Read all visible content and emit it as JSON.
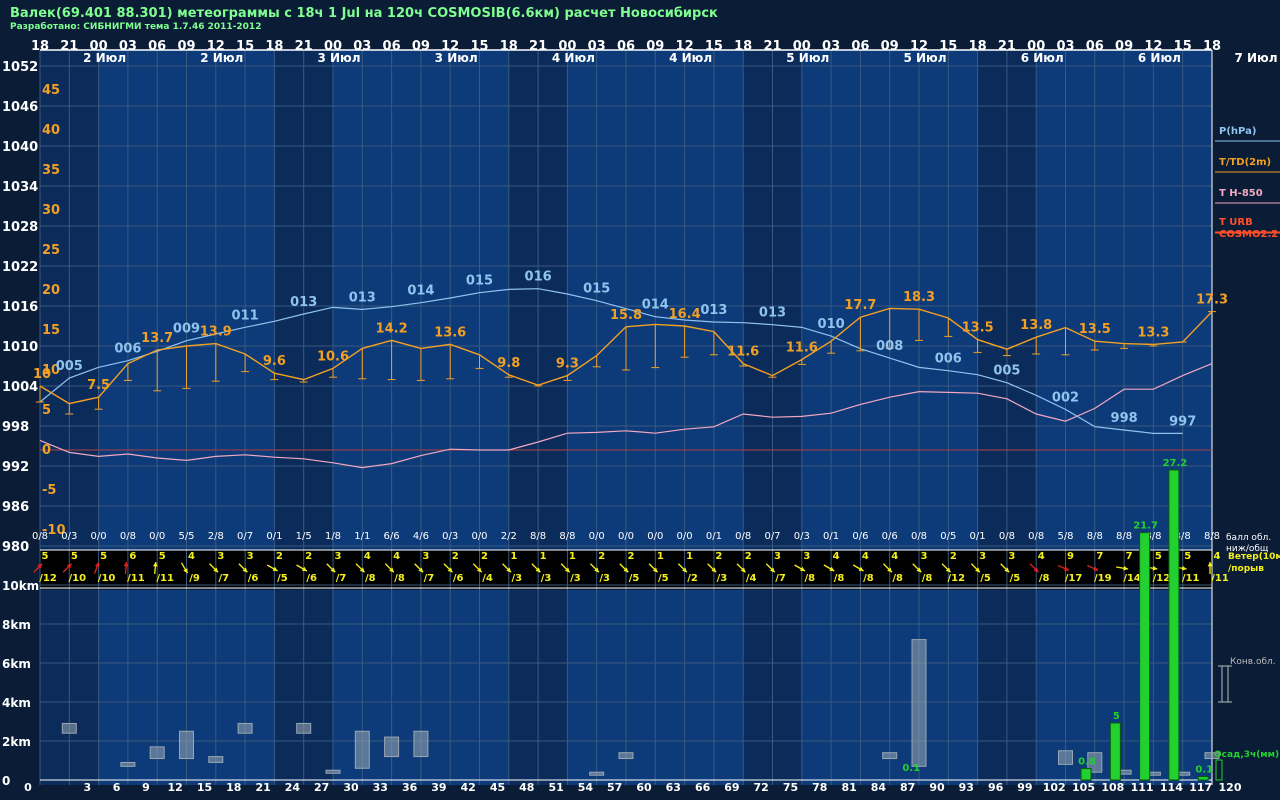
{
  "title": "Валек(69.401 88.301) метеограммы с  18ч 1 Jul на 120ч COSMOSIB(6.6км) расчет Новосибирск",
  "subtitle": "Разработано: СИБНИГМИ тема 1.7.46 2011-2012",
  "colors": {
    "pressure": "#8fc4ef",
    "temp": "#f2a024",
    "t850": "#f1a8c0",
    "urb": "#ff4f2a",
    "zero": "#b04040",
    "wind_yellow": "#f4f01c",
    "wind_red": "#e02020",
    "precip": "#22d030",
    "cloud": "#9aa7b2"
  },
  "chart_data": {
    "type": "line",
    "hours_top": [
      "18",
      "21",
      "00",
      "03",
      "06",
      "09",
      "12",
      "15",
      "18",
      "21",
      "00",
      "03",
      "06",
      "09",
      "12",
      "15",
      "18",
      "21",
      "00",
      "03",
      "06",
      "09",
      "12",
      "15",
      "18",
      "21",
      "00",
      "03",
      "06",
      "09",
      "12",
      "15",
      "18",
      "21",
      "00",
      "03",
      "06",
      "09",
      "12",
      "15",
      "18"
    ],
    "hours_bottom": [
      "0",
      "3",
      "6",
      "9",
      "12",
      "15",
      "18",
      "21",
      "24",
      "27",
      "30",
      "33",
      "36",
      "39",
      "42",
      "45",
      "48",
      "51",
      "54",
      "57",
      "60",
      "63",
      "66",
      "69",
      "72",
      "75",
      "78",
      "81",
      "84",
      "87",
      "90",
      "93",
      "96",
      "99",
      "102",
      "105",
      "108",
      "111",
      "114",
      "117",
      "120"
    ],
    "dates": [
      {
        "h": 6,
        "label": "2 Июл"
      },
      {
        "h": 18,
        "label": "2 Июл"
      },
      {
        "h": 30,
        "label": "3 Июл"
      },
      {
        "h": 42,
        "label": "3 Июл"
      },
      {
        "h": 54,
        "label": "4 Июл"
      },
      {
        "h": 66,
        "label": "4 Июл"
      },
      {
        "h": 78,
        "label": "5 Июл"
      },
      {
        "h": 90,
        "label": "5 Июл"
      },
      {
        "h": 102,
        "label": "6 Июл"
      },
      {
        "h": 114,
        "label": "6 Июл"
      }
    ],
    "date_right": "7 Июл",
    "pressure_ticks": [
      "1052",
      "1046",
      "1040",
      "1034",
      "1028",
      "1022",
      "1016",
      "1010",
      "1004",
      "998",
      "992",
      "986",
      "980"
    ],
    "temp_ticks": [
      "45",
      "40",
      "35",
      "30",
      "25",
      "20",
      "15",
      "10",
      "5",
      "0",
      "-5",
      "-10"
    ],
    "pressure": [
      1001.6,
      1005.2,
      1006.8,
      1007.8,
      1009.2,
      1010.8,
      1011.8,
      1012.8,
      1013.7,
      1014.8,
      1015.8,
      1015.5,
      1015.9,
      1016.5,
      1017.2,
      1018.0,
      1018.5,
      1018.6,
      1017.8,
      1016.8,
      1015.6,
      1014.4,
      1013.9,
      1013.6,
      1013.5,
      1013.2,
      1012.8,
      1011.5,
      1009.6,
      1008.2,
      1006.8,
      1006.3,
      1005.7,
      1004.5,
      1002.6,
      1000.5,
      997.9,
      997.4,
      996.9,
      996.9
    ],
    "pressure_labels": [
      {
        "h": 3,
        "text": "005"
      },
      {
        "h": 9,
        "text": "006"
      },
      {
        "h": 15,
        "text": "009"
      },
      {
        "h": 21,
        "text": "011"
      },
      {
        "h": 27,
        "text": "013"
      },
      {
        "h": 33,
        "text": "013"
      },
      {
        "h": 39,
        "text": "014"
      },
      {
        "h": 45,
        "text": "015"
      },
      {
        "h": 51,
        "text": "016"
      },
      {
        "h": 57,
        "text": "015"
      },
      {
        "h": 63,
        "text": "014"
      },
      {
        "h": 69,
        "text": "013"
      },
      {
        "h": 75,
        "text": "013"
      },
      {
        "h": 81,
        "text": "010"
      },
      {
        "h": 87,
        "text": "008"
      },
      {
        "h": 93,
        "text": "006"
      },
      {
        "h": 99,
        "text": "005"
      },
      {
        "h": 105,
        "text": "002"
      },
      {
        "h": 111,
        "text": "998"
      },
      {
        "h": 117,
        "text": "997"
      }
    ],
    "temp": [
      8.0,
      5.8,
      6.6,
      10.8,
      12.5,
      13.0,
      13.3,
      12.0,
      9.6,
      8.8,
      10.2,
      12.7,
      13.7,
      12.7,
      13.2,
      11.9,
      9.4,
      8.1,
      9.3,
      11.8,
      15.4,
      15.7,
      15.5,
      14.8,
      10.8,
      9.3,
      11.3,
      13.6,
      16.6,
      17.7,
      17.6,
      16.5,
      13.8,
      12.6,
      14.1,
      15.3,
      13.6,
      13.3,
      13.2,
      13.5,
      17.3
    ],
    "td_bottom": [
      6.0,
      4.5,
      5.1,
      8.7,
      7.4,
      7.7,
      8.6,
      9.8,
      8.8,
      8.5,
      9.1,
      8.9,
      8.8,
      8.7,
      8.9,
      10.2,
      9.1,
      8.0,
      8.7,
      10.4,
      10.0,
      10.3,
      11.6,
      11.9,
      10.5,
      9.1,
      10.7,
      12.1,
      12.4,
      12.7,
      13.7,
      14.2,
      12.2,
      11.8,
      12.0,
      11.9,
      12.5,
      12.7,
      13.0,
      13.5,
      17.3
    ],
    "temp_labels": [
      {
        "h": 0,
        "text": "10"
      },
      {
        "h": 6,
        "text": "7.5"
      },
      {
        "h": 12,
        "text": "13.7"
      },
      {
        "h": 18,
        "text": "13.9"
      },
      {
        "h": 24,
        "text": "9.6"
      },
      {
        "h": 30,
        "text": "10.6"
      },
      {
        "h": 36,
        "text": "14.2"
      },
      {
        "h": 42,
        "text": "13.6"
      },
      {
        "h": 48,
        "text": "9.8"
      },
      {
        "h": 54,
        "text": "9.3"
      },
      {
        "h": 60,
        "text": "15.8"
      },
      {
        "h": 66,
        "text": "16.4"
      },
      {
        "h": 72,
        "text": "11.6"
      },
      {
        "h": 78,
        "text": "11.6"
      },
      {
        "h": 84,
        "text": "17.7"
      },
      {
        "h": 90,
        "text": "18.3"
      },
      {
        "h": 96,
        "text": "13.5"
      },
      {
        "h": 102,
        "text": "13.8"
      },
      {
        "h": 108,
        "text": "13.5"
      },
      {
        "h": 114,
        "text": "13.3"
      },
      {
        "h": 120,
        "text": "17.3"
      }
    ],
    "t850": [
      1.2,
      -0.3,
      -0.8,
      -0.5,
      -1.0,
      -1.3,
      -0.8,
      -0.6,
      -0.9,
      -1.1,
      -1.6,
      -2.2,
      -1.7,
      -0.7,
      0.1,
      0.0,
      0.0,
      1.0,
      2.1,
      2.2,
      2.4,
      2.1,
      2.6,
      2.9,
      4.5,
      4.1,
      4.2,
      4.6,
      5.7,
      6.6,
      7.3,
      7.2,
      7.1,
      6.4,
      4.5,
      3.6,
      5.2,
      7.6,
      7.6,
      9.3,
      10.8
    ],
    "clouds": [
      "0/8",
      "0/3",
      "0/0",
      "0/8",
      "0/0",
      "5/5",
      "2/8",
      "0/7",
      "0/1",
      "1/5",
      "1/8",
      "1/1",
      "6/6",
      "4/6",
      "0/3",
      "0/0",
      "2/2",
      "8/8",
      "8/8",
      "0/0",
      "0/0",
      "0/0",
      "0/0",
      "0/1",
      "0/8",
      "0/7",
      "0/3",
      "0/1",
      "0/6",
      "0/6",
      "0/8",
      "0/5",
      "0/1",
      "0/8",
      "0/8",
      "5/8",
      "8/8",
      "8/8",
      "8/8",
      "8/8",
      "8/8"
    ],
    "wind": [
      {
        "s": "5",
        "g": "/12",
        "c": "r",
        "d": 45
      },
      {
        "s": "5",
        "g": "/10",
        "c": "r",
        "d": 45
      },
      {
        "s": "5",
        "g": "/10",
        "c": "r",
        "d": 20
      },
      {
        "s": "6",
        "g": "/11",
        "c": "r",
        "d": 5
      },
      {
        "s": "5",
        "g": "/11",
        "c": "y",
        "d": 5
      },
      {
        "s": "4",
        "g": "/9",
        "c": "y",
        "d": 150
      },
      {
        "s": "3",
        "g": "/7",
        "c": "y",
        "d": 135
      },
      {
        "s": "3",
        "g": "/6",
        "c": "y",
        "d": 135
      },
      {
        "s": "2",
        "g": "/5",
        "c": "y",
        "d": 120
      },
      {
        "s": "2",
        "g": "/6",
        "c": "y",
        "d": 120
      },
      {
        "s": "3",
        "g": "/7",
        "c": "y",
        "d": 135
      },
      {
        "s": "4",
        "g": "/8",
        "c": "y",
        "d": 135
      },
      {
        "s": "4",
        "g": "/8",
        "c": "y",
        "d": 135
      },
      {
        "s": "3",
        "g": "/7",
        "c": "y",
        "d": 135
      },
      {
        "s": "2",
        "g": "/6",
        "c": "y",
        "d": 135
      },
      {
        "s": "2",
        "g": "/4",
        "c": "y",
        "d": 135
      },
      {
        "s": "1",
        "g": "/3",
        "c": "y",
        "d": 135
      },
      {
        "s": "1",
        "g": "/3",
        "c": "y",
        "d": 135
      },
      {
        "s": "1",
        "g": "/3",
        "c": "y",
        "d": 135
      },
      {
        "s": "2",
        "g": "/3",
        "c": "y",
        "d": 135
      },
      {
        "s": "2",
        "g": "/5",
        "c": "y",
        "d": 135
      },
      {
        "s": "1",
        "g": "/5",
        "c": "y",
        "d": 135
      },
      {
        "s": "1",
        "g": "/2",
        "c": "y",
        "d": 135
      },
      {
        "s": "2",
        "g": "/3",
        "c": "y",
        "d": 135
      },
      {
        "s": "2",
        "g": "/4",
        "c": "y",
        "d": 135
      },
      {
        "s": "3",
        "g": "/7",
        "c": "y",
        "d": 135
      },
      {
        "s": "3",
        "g": "/8",
        "c": "y",
        "d": 120
      },
      {
        "s": "4",
        "g": "/8",
        "c": "y",
        "d": 120
      },
      {
        "s": "4",
        "g": "/8",
        "c": "y",
        "d": 120
      },
      {
        "s": "4",
        "g": "/8",
        "c": "y",
        "d": 135
      },
      {
        "s": "3",
        "g": "/8",
        "c": "y",
        "d": 135
      },
      {
        "s": "2",
        "g": "/12",
        "c": "y",
        "d": 135
      },
      {
        "s": "3",
        "g": "/5",
        "c": "y",
        "d": 135
      },
      {
        "s": "3",
        "g": "/5",
        "c": "y",
        "d": 135
      },
      {
        "s": "4",
        "g": "/8",
        "c": "r",
        "d": 135
      },
      {
        "s": "9",
        "g": "/17",
        "c": "r",
        "d": 115
      },
      {
        "s": "7",
        "g": "/19",
        "c": "r",
        "d": 115
      },
      {
        "s": "7",
        "g": "/14",
        "c": "y",
        "d": 100
      },
      {
        "s": "5",
        "g": "/12",
        "c": "y",
        "d": 100
      },
      {
        "s": "5",
        "g": "/11",
        "c": "y",
        "d": 100
      },
      {
        "s": "4",
        "g": "/11",
        "c": "y",
        "d": 0
      }
    ],
    "precip": [
      {
        "h": 107,
        "v": 1.0,
        "label": "0.8"
      },
      {
        "h": 110,
        "v": 5.0,
        "label": "5"
      },
      {
        "h": 113,
        "v": 21.7,
        "label": "21.7"
      },
      {
        "h": 116,
        "v": 27.2,
        "label": "27.2"
      },
      {
        "h": 119,
        "v": 0.3,
        "label": "0.1"
      },
      {
        "h": 89,
        "v": 0.0,
        "label": "0.1"
      }
    ],
    "cloud_bars": [
      {
        "h": 3,
        "lo": 2.4,
        "hi": 2.9
      },
      {
        "h": 9,
        "lo": 0.7,
        "hi": 0.9
      },
      {
        "h": 12,
        "lo": 1.1,
        "hi": 1.7
      },
      {
        "h": 15,
        "lo": 1.1,
        "hi": 2.5
      },
      {
        "h": 18,
        "lo": 0.9,
        "hi": 1.2
      },
      {
        "h": 21,
        "lo": 2.4,
        "hi": 2.9
      },
      {
        "h": 27,
        "lo": 2.4,
        "hi": 2.9
      },
      {
        "h": 30,
        "lo": 0.4,
        "hi": 0.5
      },
      {
        "h": 33,
        "lo": 0.6,
        "hi": 2.5
      },
      {
        "h": 36,
        "lo": 1.2,
        "hi": 2.2
      },
      {
        "h": 39,
        "lo": 1.2,
        "hi": 2.5
      },
      {
        "h": 57,
        "lo": 0.3,
        "hi": 0.4
      },
      {
        "h": 60,
        "lo": 1.1,
        "hi": 1.4
      },
      {
        "h": 87,
        "lo": 1.1,
        "hi": 1.4
      },
      {
        "h": 90,
        "lo": 0.7,
        "hi": 7.2
      },
      {
        "h": 105,
        "lo": 0.8,
        "hi": 1.5
      },
      {
        "h": 108,
        "lo": 0.4,
        "hi": 1.4
      },
      {
        "h": 111,
        "lo": 0.3,
        "hi": 0.5
      },
      {
        "h": 114,
        "lo": 0.3,
        "hi": 0.4
      },
      {
        "h": 117,
        "lo": 0.3,
        "hi": 0.4
      },
      {
        "h": 120,
        "lo": 1.1,
        "hi": 1.4
      }
    ],
    "km_ticks": [
      "10km",
      "8km",
      "6km",
      "4km",
      "2km",
      "0"
    ],
    "legend": [
      {
        "text": "P(hPa)",
        "color": "#8fc4ef"
      },
      {
        "text": "T/TD(2m)",
        "color": "#f2a024"
      },
      {
        "text": "T H-850",
        "color": "#f1a8c0"
      },
      {
        "text": "T URB",
        "color": "#ff4f2a"
      },
      {
        "text": "COSMO2.2",
        "color": "#ff4f2a"
      }
    ],
    "right_labels": {
      "clouds": "балл обл.",
      "clouds2": "ниж/общ",
      "wind": "Ветер(10м",
      "wind2": "/порыв",
      "conv": "Конв.обл.",
      "precip": "Осад,3ч(мм)"
    }
  }
}
